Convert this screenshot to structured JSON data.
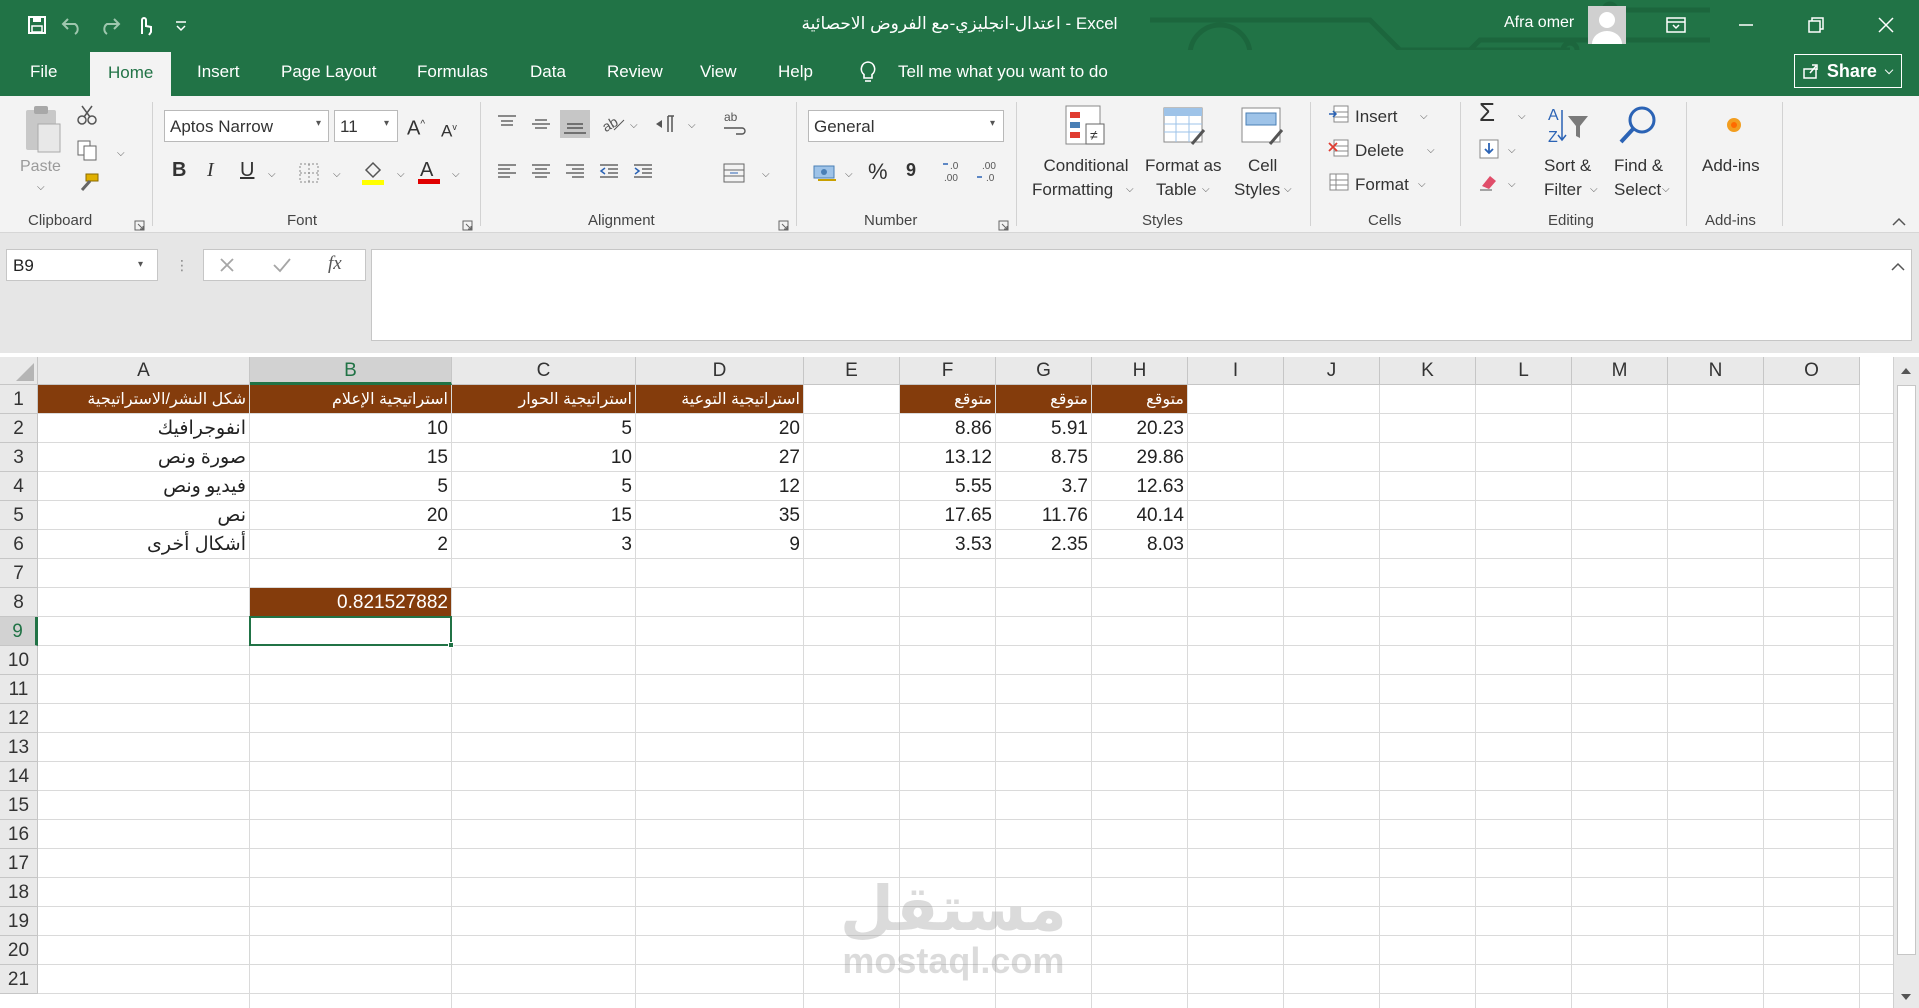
{
  "window": {
    "title": "اعتدال-انجليزي-مع الفروض الاحصائية  -  Excel",
    "user": "Afra omer"
  },
  "tabs": [
    "File",
    "Home",
    "Insert",
    "Page Layout",
    "Formulas",
    "Data",
    "Review",
    "View",
    "Help"
  ],
  "tell_me": "Tell me what you want to do",
  "share_label": "Share",
  "ribbon": {
    "clipboard": {
      "paste": "Paste",
      "label": "Clipboard"
    },
    "font": {
      "name": "Aptos Narrow",
      "size": "11",
      "label": "Font"
    },
    "alignment": {
      "label": "Alignment"
    },
    "number": {
      "format": "General",
      "label": "Number",
      "percent": "%",
      "comma": "9"
    },
    "styles": {
      "conditional_1": "Conditional",
      "conditional_2": "Formatting",
      "format_table_1": "Format as",
      "format_table_2": "Table",
      "cell_styles_1": "Cell",
      "cell_styles_2": "Styles",
      "label": "Styles"
    },
    "cells": {
      "insert": "Insert",
      "delete": "Delete",
      "format": "Format",
      "label": "Cells"
    },
    "editing": {
      "sort_1": "Sort &",
      "sort_2": "Filter",
      "find_1": "Find &",
      "find_2": "Select",
      "label": "Editing"
    },
    "addins": {
      "button": "Add-ins",
      "label": "Add-ins"
    }
  },
  "formula_bar": {
    "name_box": "B9",
    "fx": "fx",
    "formula": ""
  },
  "columns": [
    "A",
    "B",
    "C",
    "D",
    "E",
    "F",
    "G",
    "H",
    "I",
    "J",
    "K",
    "L",
    "M",
    "N",
    "O"
  ],
  "rows": [
    "1",
    "2",
    "3",
    "4",
    "5",
    "6",
    "7",
    "8",
    "9",
    "10",
    "11",
    "12",
    "13",
    "14",
    "15",
    "16",
    "17",
    "18",
    "19",
    "20",
    "21"
  ],
  "selected_cell": "B9",
  "sheet": {
    "headers": {
      "A1": "شكل النشر/الاستراتيجية",
      "B1": "استراتيجية الإعلام",
      "C1": "استراتيجية الحوار",
      "D1": "استراتيجية التوعية",
      "F1": "متوقع",
      "G1": "متوقع",
      "H1": "متوقع"
    },
    "data_rows": [
      {
        "A": "انفوجرافيك",
        "B": "10",
        "C": "5",
        "D": "20",
        "F": "8.86",
        "G": "5.91",
        "H": "20.23"
      },
      {
        "A": "صورة ونص",
        "B": "15",
        "C": "10",
        "D": "27",
        "F": "13.12",
        "G": "8.75",
        "H": "29.86"
      },
      {
        "A": "فيديو ونص",
        "B": "5",
        "C": "5",
        "D": "12",
        "F": "5.55",
        "G": "3.7",
        "H": "12.63"
      },
      {
        "A": "نص",
        "B": "20",
        "C": "15",
        "D": "35",
        "F": "17.65",
        "G": "11.76",
        "H": "40.14"
      },
      {
        "A": "أشكال أخرى",
        "B": "2",
        "C": "3",
        "D": "9",
        "F": "3.53",
        "G": "2.35",
        "H": "8.03"
      }
    ],
    "B8": "0.821527882"
  },
  "watermark": {
    "arabic": "مستقل",
    "latin": "mostaql.com"
  },
  "colors": {
    "excel_green": "#217346",
    "header_fill": "#843c0c"
  }
}
